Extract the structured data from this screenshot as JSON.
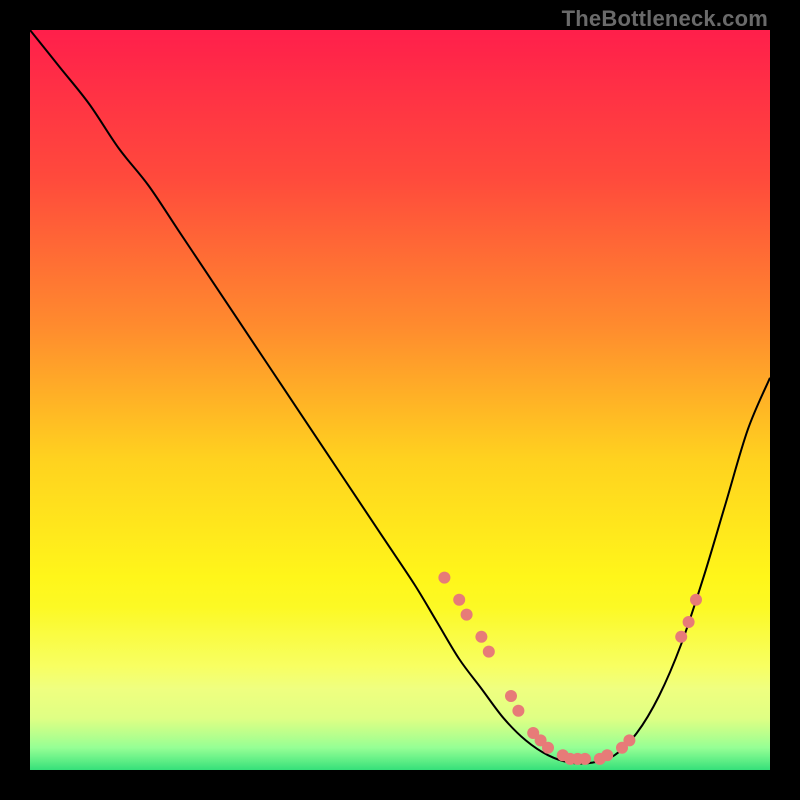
{
  "watermark": "TheBottleneck.com",
  "chart_data": {
    "type": "line",
    "title": "",
    "xlabel": "",
    "ylabel": "",
    "xlim": [
      0,
      100
    ],
    "ylim": [
      0,
      100
    ],
    "grid": false,
    "legend": false,
    "background_gradient": {
      "stops": [
        {
          "offset": 0.0,
          "color": "#ff1f4b"
        },
        {
          "offset": 0.2,
          "color": "#ff4a3c"
        },
        {
          "offset": 0.4,
          "color": "#ff8b2e"
        },
        {
          "offset": 0.58,
          "color": "#ffd21f"
        },
        {
          "offset": 0.74,
          "color": "#fff61a"
        },
        {
          "offset": 0.86,
          "color": "#f6ff3a"
        },
        {
          "offset": 0.93,
          "color": "#d8ff6a"
        },
        {
          "offset": 0.97,
          "color": "#8cff8c"
        },
        {
          "offset": 1.0,
          "color": "#35e07a"
        }
      ]
    },
    "haze_band": {
      "top_fraction": 0.78,
      "bottom_fraction": 1.0,
      "color_top": "rgba(255,255,255,0.0)",
      "color_mid": "rgba(255,255,255,0.28)",
      "color_bottom": "rgba(255,255,255,0.0)"
    },
    "series": [
      {
        "name": "bottleneck-curve",
        "color": "#000000",
        "stroke_width": 2,
        "x": [
          0,
          4,
          8,
          12,
          16,
          20,
          24,
          28,
          32,
          36,
          40,
          44,
          48,
          52,
          55,
          58,
          61,
          64,
          67,
          70,
          73,
          76,
          79,
          82,
          85,
          88,
          91,
          94,
          97,
          100
        ],
        "y": [
          100,
          95,
          90,
          84,
          79,
          73,
          67,
          61,
          55,
          49,
          43,
          37,
          31,
          25,
          20,
          15,
          11,
          7,
          4,
          2,
          1,
          1,
          2,
          5,
          10,
          17,
          26,
          36,
          46,
          53
        ]
      }
    ],
    "markers": {
      "name": "curve-dots",
      "color": "#e77b78",
      "radius": 6,
      "points": [
        {
          "x": 56,
          "y": 26
        },
        {
          "x": 58,
          "y": 23
        },
        {
          "x": 59,
          "y": 21
        },
        {
          "x": 61,
          "y": 18
        },
        {
          "x": 62,
          "y": 16
        },
        {
          "x": 65,
          "y": 10
        },
        {
          "x": 66,
          "y": 8
        },
        {
          "x": 68,
          "y": 5
        },
        {
          "x": 69,
          "y": 4
        },
        {
          "x": 70,
          "y": 3
        },
        {
          "x": 72,
          "y": 2
        },
        {
          "x": 73,
          "y": 1.5
        },
        {
          "x": 74,
          "y": 1.5
        },
        {
          "x": 75,
          "y": 1.5
        },
        {
          "x": 77,
          "y": 1.5
        },
        {
          "x": 78,
          "y": 2
        },
        {
          "x": 80,
          "y": 3
        },
        {
          "x": 81,
          "y": 4
        },
        {
          "x": 88,
          "y": 18
        },
        {
          "x": 89,
          "y": 20
        },
        {
          "x": 90,
          "y": 23
        }
      ]
    }
  }
}
